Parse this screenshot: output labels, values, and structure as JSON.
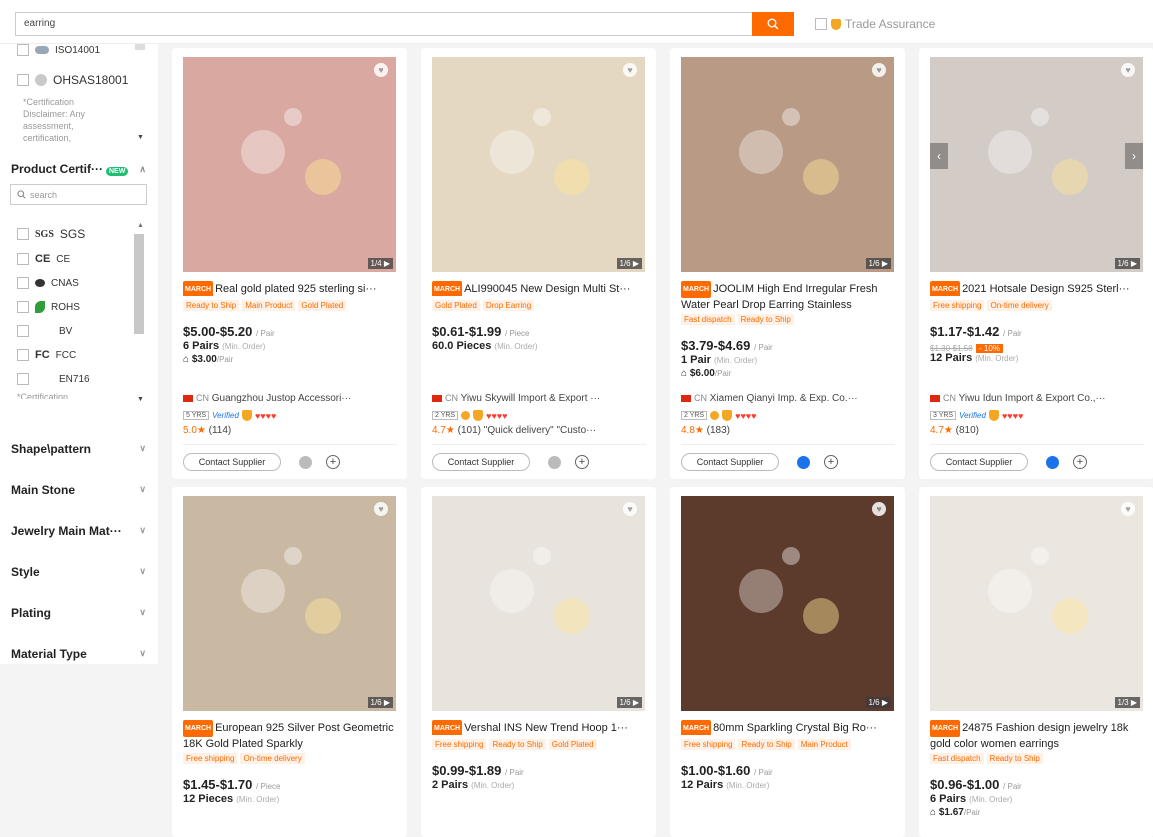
{
  "search": {
    "value": "earring",
    "trade_assurance": "Trade Assurance"
  },
  "sidebar": {
    "cert_top": [
      "ISO14001",
      "OHSAS18001"
    ],
    "disclaimer": "*Certification Disclaimer: Any assessment, certification,",
    "product_cert_title": "Product Certif···",
    "new_badge": "NEW",
    "search_placeholder": "search",
    "product_certs": [
      {
        "logo": "SGS",
        "label": "SGS"
      },
      {
        "logo": "CE",
        "label": "CE"
      },
      {
        "logo": "",
        "label": "CNAS"
      },
      {
        "logo": "",
        "label": "ROHS"
      },
      {
        "logo": "",
        "label": "BV"
      },
      {
        "logo": "FC",
        "label": "FCC"
      },
      {
        "logo": "",
        "label": "EN716"
      }
    ],
    "disclaimer2": "*Certification",
    "filters": [
      "Shape\\pattern",
      "Main Stone",
      "Jewelry Main Mat···",
      "Style",
      "Plating",
      "Material Type"
    ]
  },
  "products": [
    {
      "title": "Real gold plated 925 sterling si···",
      "tags": [
        "Ready to Ship",
        "Main Product",
        "Gold Plated"
      ],
      "price": "$5.00-$5.20",
      "unit": "/ Pair",
      "moq": "6 Pairs",
      "moq_note": "(Min. Order)",
      "sample": "$3.00",
      "sample_unit": "/Pair",
      "supplier": "Guangzhou Justop Accessori···",
      "yrs": "5 YRS",
      "verified": "Verified",
      "score": "5.0★",
      "reviews": "(114)",
      "count": "1/4",
      "contact": "Contact Supplier",
      "img_color": "#d9a9a1"
    },
    {
      "title": "ALI990045 New Design Multi St···",
      "tags": [
        "Gold Plated",
        "Drop Earring"
      ],
      "price": "$0.61-$1.99",
      "unit": "/ Piece",
      "moq": "60.0 Pieces",
      "moq_note": "(Min. Order)",
      "supplier": "Yiwu Skywill Import & Export ···",
      "yrs": "2 YRS",
      "score": "4.7★",
      "reviews": "(101) \"Quick delivery\" \"Custo···",
      "count": "1/6",
      "contact": "Contact Supplier",
      "img_color": "#e4d8c2"
    },
    {
      "title": "JOOLIM High End Irregular Fresh Water Pearl Drop Earring Stainless",
      "tags": [
        "Fast dispatch",
        "Ready to Ship"
      ],
      "price": "$3.79-$4.69",
      "unit": "/ Pair",
      "moq": "1 Pair",
      "moq_note": "(Min. Order)",
      "sample": "$6.00",
      "sample_unit": "/Pair",
      "supplier": "Xiamen Qianyi Imp. & Exp. Co.···",
      "yrs": "2 YRS",
      "score": "4.8★",
      "reviews": "(183)",
      "count": "1/6",
      "contact": "Contact Supplier",
      "img_color": "#b89a85"
    },
    {
      "title": "2021 Hotsale Design S925 Sterl···",
      "tags": [
        "Free shipping",
        "On-time delivery"
      ],
      "price": "$1.17-$1.42",
      "unit": "/ Pair",
      "old_price": "$1.30-$1.58",
      "discount": "- 10%",
      "moq": "12 Pairs",
      "moq_note": "(Min. Order)",
      "supplier": "Yiwu Idun Import & Export Co.,···",
      "yrs": "3 YRS",
      "verified": "Verified",
      "score": "4.7★",
      "reviews": "(810)",
      "count": "1/6",
      "contact": "Contact Supplier",
      "img_color": "#d3cbc6"
    },
    {
      "title": "European 925 Silver Post Geometric 18K Gold Plated Sparkly",
      "tags": [
        "Free shipping",
        "On-time delivery"
      ],
      "price": "$1.45-$1.70",
      "unit": "/ Piece",
      "moq": "12 Pieces",
      "moq_note": "(Min. Order)",
      "count": "1/6",
      "img_color": "#c9b9a3"
    },
    {
      "title": "Vershal INS New Trend Hoop 1···",
      "tags": [
        "Free shipping",
        "Ready to Ship",
        "Gold Plated"
      ],
      "price": "$0.99-$1.89",
      "unit": "/ Pair",
      "moq": "2 Pairs",
      "moq_note": "(Min. Order)",
      "count": "1/6",
      "img_color": "#e8e3dc"
    },
    {
      "title": "80mm Sparkling Crystal Big Ro···",
      "tags": [
        "Free shipping",
        "Ready to Ship",
        "Main Product"
      ],
      "price": "$1.00-$1.60",
      "unit": "/ Pair",
      "moq": "12 Pairs",
      "moq_note": "(Min. Order)",
      "count": "1/6",
      "img_color": "#5c3b2c"
    },
    {
      "title": "24875 Fashion design jewelry 18k gold color women earrings",
      "tags": [
        "Fast dispatch",
        "Ready to Ship"
      ],
      "price": "$0.96-$1.00",
      "unit": "/ Pair",
      "moq": "6 Pairs",
      "moq_note": "(Min. Order)",
      "sample": "$1.67",
      "sample_unit": "/Pair",
      "count": "1/3",
      "img_color": "#ece6e0"
    }
  ]
}
